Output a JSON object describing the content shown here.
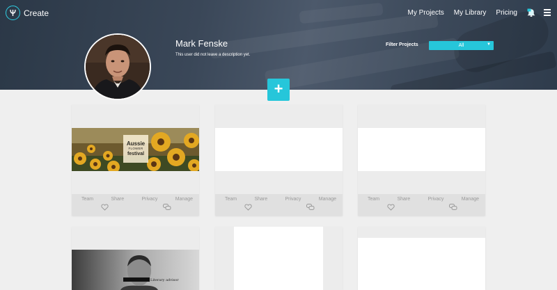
{
  "app": {
    "name": "Create"
  },
  "nav": {
    "items": [
      "My Projects",
      "My Library",
      "Pricing"
    ],
    "icons": [
      "notification-bell-icon",
      "hamburger-menu-icon"
    ]
  },
  "profile": {
    "name": "Mark Fenske",
    "description": "This user did not leave a description yet."
  },
  "filter": {
    "label": "Filter Projects",
    "selected": "All"
  },
  "add_button": {
    "label": "+"
  },
  "card_actions": [
    "Team",
    "Share",
    "Privacy",
    "Manage"
  ],
  "cards": [
    {
      "thumbnail": "aussie-flower-festival",
      "label": {
        "line1": "Aussie",
        "line2": "FLOWER",
        "line3": "festival"
      }
    },
    {
      "thumbnail": "blank"
    },
    {
      "thumbnail": "blank"
    },
    {
      "thumbnail": "literary-advisor",
      "label": "Literary advisor"
    },
    {
      "thumbnail": "blank"
    },
    {
      "thumbnail": "blank"
    }
  ],
  "colors": {
    "accent": "#26c6da",
    "header_bg": "#3a4758",
    "page_bg": "#efefef",
    "footer_bg": "#e0e0e0"
  }
}
